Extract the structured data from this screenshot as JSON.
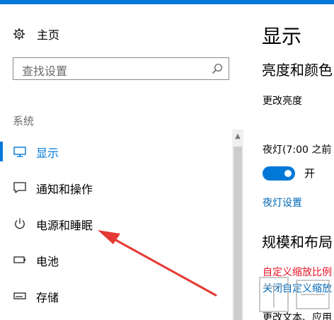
{
  "colors": {
    "accent": "#0078d7",
    "annotation_red": "#e53935",
    "error_red": "#e81123"
  },
  "home": {
    "label": "主页",
    "icon": "gear-icon"
  },
  "search": {
    "placeholder": "查找设置",
    "icon": "search-icon"
  },
  "section": {
    "title": "系统"
  },
  "nav": {
    "items": [
      {
        "label": "显示",
        "icon": "monitor-icon",
        "active": true
      },
      {
        "label": "通知和操作",
        "icon": "notification-icon",
        "active": false
      },
      {
        "label": "电源和睡眠",
        "icon": "power-icon",
        "active": false
      },
      {
        "label": "电池",
        "icon": "battery-icon",
        "active": false
      },
      {
        "label": "存储",
        "icon": "storage-icon",
        "active": false
      }
    ]
  },
  "right": {
    "title": "显示",
    "brightness_heading": "亮度和颜色",
    "change_brightness": "更改亮度",
    "night_light_label": "夜灯(7:00 之前",
    "toggle_state": "开",
    "night_light_settings": "夜灯设置",
    "scale_heading": "规模和布局",
    "custom_scale_warning": "自定义缩放比例",
    "turn_off_custom_scale": "关闭自定义缩放",
    "change_text_size": "更改文本、应用"
  }
}
